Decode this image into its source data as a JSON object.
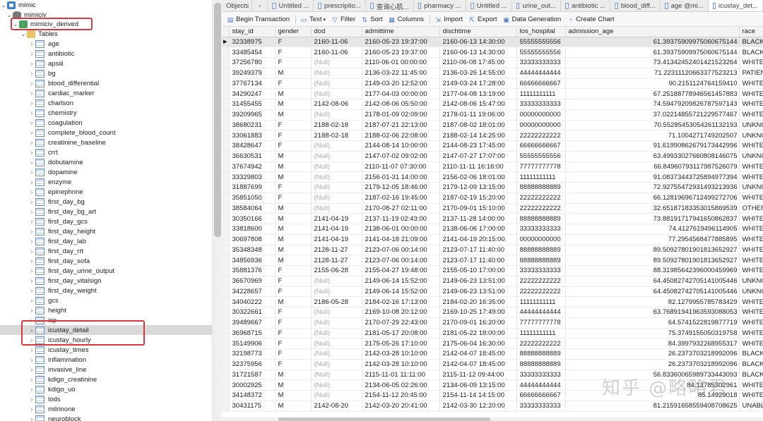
{
  "tree": {
    "connection": "mimic",
    "database": "mimiciv",
    "schema": "mimiciv_derived",
    "folder": "Tables",
    "tables": [
      "age",
      "antibiotic",
      "apsiii",
      "bg",
      "blood_differential",
      "cardiac_marker",
      "charlson",
      "chemistry",
      "coagulation",
      "complete_blood_count",
      "creatinine_baseline",
      "crrt",
      "dobutamine",
      "dopamine",
      "enzyme",
      "epinephrine",
      "first_day_bg",
      "first_day_bg_art",
      "first_day_gcs",
      "first_day_height",
      "first_day_lab",
      "first_day_rrt",
      "first_day_sofa",
      "first_day_urine_output",
      "first_day_vitalsign",
      "first_day_weight",
      "gcs",
      "height",
      "icp",
      "icustay_detail",
      "icustay_hourly",
      "icustay_times",
      "inflammation",
      "invasive_line",
      "kdigo_creatinine",
      "kdigo_uo",
      "lods",
      "milrinone",
      "neuroblock"
    ],
    "selected": "icustay_detail"
  },
  "tabs": [
    "Objects",
    "Untitled ...",
    "prescriptio...",
    "查询心肌...",
    "pharmacy ...",
    "Untitled ...",
    "urine_out...",
    "antibiotic ...",
    "blood_diff...",
    "age @mi...",
    "icustay_det..."
  ],
  "toolbar": {
    "begin_transaction": "Begin Transaction",
    "text": "Text",
    "filter": "Filter",
    "sort": "Sort",
    "columns": "Columns",
    "import": "Import",
    "export": "Export",
    "data_generation": "Data Generation",
    "create_chart": "Create Chart"
  },
  "grid": {
    "columns": [
      "stay_id",
      "gender",
      "dod",
      "admittime",
      "dischtime",
      "los_hospital",
      "admission_age",
      "race"
    ],
    "rows": [
      [
        "32338975",
        "F",
        "2160-11-06",
        "2160-05-23 19:37:00",
        "2160-06-13 14:30:00",
        "55555555556",
        "61.39375909975060675144",
        "BLACK,"
      ],
      [
        "33485454",
        "F",
        "2160-11-06",
        "2160-05-23 19:37:00",
        "2160-06-13 14:30:00",
        "55555555556",
        "61.39375909975060675144",
        "BLACK,"
      ],
      [
        "37256780",
        "F",
        "(Null)",
        "2110-06-01 00:00:00",
        "2110-06-08 17:45:00",
        "33333333333",
        "73.41342452401421523264",
        "WHITE"
      ],
      [
        "39249379",
        "M",
        "(Null)",
        "2136-03-22 11:45:00",
        "2136-03-26 14:55:00",
        "44444444444",
        "71.22311120663377523213",
        "PATIEN"
      ],
      [
        "37767134",
        "F",
        "(Null)",
        "2149-03-20 12:52:00",
        "2149-03-24 17:28:00",
        "66666666667",
        "90.2151124764159410",
        "WHITE"
      ],
      [
        "34290247",
        "M",
        "(Null)",
        "2177-04-03 00:00:00",
        "2177-04-08 13:19:00",
        "11111111111",
        "67.25188778946561457883",
        "WHITE"
      ],
      [
        "31455455",
        "M",
        "2142-08-06",
        "2142-08-06 05:50:00",
        "2142-08-06 15:47:00",
        "33333333333",
        "74.59479209826787597143",
        "WHITE"
      ],
      [
        "39209965",
        "M",
        "(Null)",
        "2178-01-09 02:09:00",
        "2178-01-11 19:06:00",
        "00000000000",
        "37.02214855721229577467",
        "WHITE"
      ],
      [
        "38680231",
        "F",
        "2188-02-18",
        "2187-07-21 22:13:00",
        "2187-08-02 18:01:00",
        "00000000000",
        "70.55285453054261132193",
        "UNKNO"
      ],
      [
        "33061883",
        "F",
        "2188-02-18",
        "2188-02-06 22:08:00",
        "2188-02-14 14:25:00",
        "22222222222",
        "71.1004271749202507",
        "UNKNO"
      ],
      [
        "38428647",
        "F",
        "(Null)",
        "2144-08-14 10:00:00",
        "2144-08-23 17:45:00",
        "66666666667",
        "91.61990862679173442996",
        "WHITE"
      ],
      [
        "36630531",
        "M",
        "(Null)",
        "2147-07-02 09:02:00",
        "2147-07-27 17:07:00",
        "55555555556",
        "63.49933027660808146075",
        "UNKNO"
      ],
      [
        "37674942",
        "M",
        "(Null)",
        "2110-11-07 07:30:00",
        "2110-11-11 16:16:00",
        "77777777778",
        "66.84960793117987526079",
        "WHITE"
      ],
      [
        "33329803",
        "M",
        "(Null)",
        "2156-01-31 14:00:00",
        "2156-02-06 18:01:00",
        "11111111111",
        "91.08373443725894977394",
        "WHITE"
      ],
      [
        "31887699",
        "F",
        "(Null)",
        "2179-12-05 18:46:00",
        "2179-12-09 13:15:00",
        "88888888889",
        "72.92755472931493213936",
        "UNKNO"
      ],
      [
        "35851050",
        "F",
        "(Null)",
        "2187-02-16 19:45:00",
        "2187-02-19 15:20:00",
        "22222222222",
        "66.12819696712499272706",
        "WHITE"
      ],
      [
        "38584064",
        "M",
        "(Null)",
        "2170-08-27 02:11:00",
        "2170-09-01 15:10:00",
        "22222222222",
        "32.65187183353015869539",
        "OTHER"
      ],
      [
        "30350166",
        "M",
        "2141-04-19",
        "2137-11-19 02:43:00",
        "2137-11-28 14:00:00",
        "88888888889",
        "73.88191717941650862837",
        "WHITE"
      ],
      [
        "33818600",
        "M",
        "2141-04-19",
        "2138-06-01 00:00:00",
        "2138-06-06 17:00:00",
        "33333333333",
        "74.4127619496114905",
        "WHITE"
      ],
      [
        "30697808",
        "M",
        "2141-04-19",
        "2141-04-18 21:09:00",
        "2141-04-19 20:15:00",
        "00000000000",
        "77.2954568477885895",
        "WHITE"
      ],
      [
        "35348348",
        "M",
        "2128-11-27",
        "2123-07-06 00:14:00",
        "2123-07-17 11:40:00",
        "88888888889",
        "89.50927801901813652927",
        "WHITE"
      ],
      [
        "34856936",
        "M",
        "2128-11-27",
        "2123-07-06 00:14:00",
        "2123-07-17 11:40:00",
        "88888888889",
        "89.50927801901813652927",
        "WHITE"
      ],
      [
        "35881376",
        "F",
        "2155-06-28",
        "2155-04-27 19:48:00",
        "2155-05-10 17:00:00",
        "33333333333",
        "88.31985642396000459969",
        "WHITE"
      ],
      [
        "36670969",
        "F",
        "(Null)",
        "2149-06-14 15:52:00",
        "2149-06-23 13:51:00",
        "22222222222",
        "64.45082742705141005446",
        "UNKNO"
      ],
      [
        "34228657",
        "F",
        "(Null)",
        "2149-06-14 15:52:00",
        "2149-06-23 13:51:00",
        "22222222222",
        "64.45082742705141005446",
        "UNKNO"
      ],
      [
        "34040222",
        "M",
        "2186-05-28",
        "2184-02-16 17:13:00",
        "2184-02-20 16:35:00",
        "11111111111",
        "82.1279955785783429",
        "WHITE"
      ],
      [
        "30322661",
        "F",
        "(Null)",
        "2169-10-08 20:12:00",
        "2169-10-25 17:49:00",
        "44444444444",
        "63.76891941963593088053",
        "WHITE"
      ],
      [
        "39489667",
        "F",
        "(Null)",
        "2170-07-29 22:43:00",
        "2170-09-01 16:20:00",
        "77777777778",
        "64.5741522819877719",
        "WHITE"
      ],
      [
        "36968715",
        "F",
        "(Null)",
        "2181-05-17 20:08:00",
        "2181-05-22 18:00:00",
        "11111111111",
        "75.3749155050319758",
        "WHITE"
      ],
      [
        "35149906",
        "F",
        "(Null)",
        "2175-05-26 17:10:00",
        "2175-06-04 16:30:00",
        "22222222222",
        "84.3997932268955317",
        "WHITE"
      ],
      [
        "32198773",
        "F",
        "(Null)",
        "2142-03-28 10:10:00",
        "2142-04-07 18:45:00",
        "88888888889",
        "26.2373703218992096",
        "BLACK,"
      ],
      [
        "32375956",
        "F",
        "(Null)",
        "2142-03-28 10:10:00",
        "2142-04-07 18:45:00",
        "88888888889",
        "26.2373703218992096",
        "BLACK,"
      ],
      [
        "31721587",
        "M",
        "(Null)",
        "2115-11-01 11:11:00",
        "2115-11-12 09:44:00",
        "33333333333",
        "56.83360065989733443093",
        "BLACK,"
      ],
      [
        "30002925",
        "M",
        "(Null)",
        "2134-06-05 02:26:00",
        "2134-06-09 13:15:00",
        "44444444444",
        "84.13785302961",
        "WHITE"
      ],
      [
        "34148372",
        "M",
        "(Null)",
        "2154-11-12 20:45:00",
        "2154-11-14 14:15:00",
        "66666666667",
        "85.14929018",
        "WHITE"
      ],
      [
        "30431175",
        "M",
        "2142-08-20",
        "2142-03-20 20:41:00",
        "2142-03-30 12:20:00",
        "33333333333",
        "81.21591658559408708625",
        "UNABL"
      ]
    ]
  },
  "watermark": "知乎 @略略君"
}
